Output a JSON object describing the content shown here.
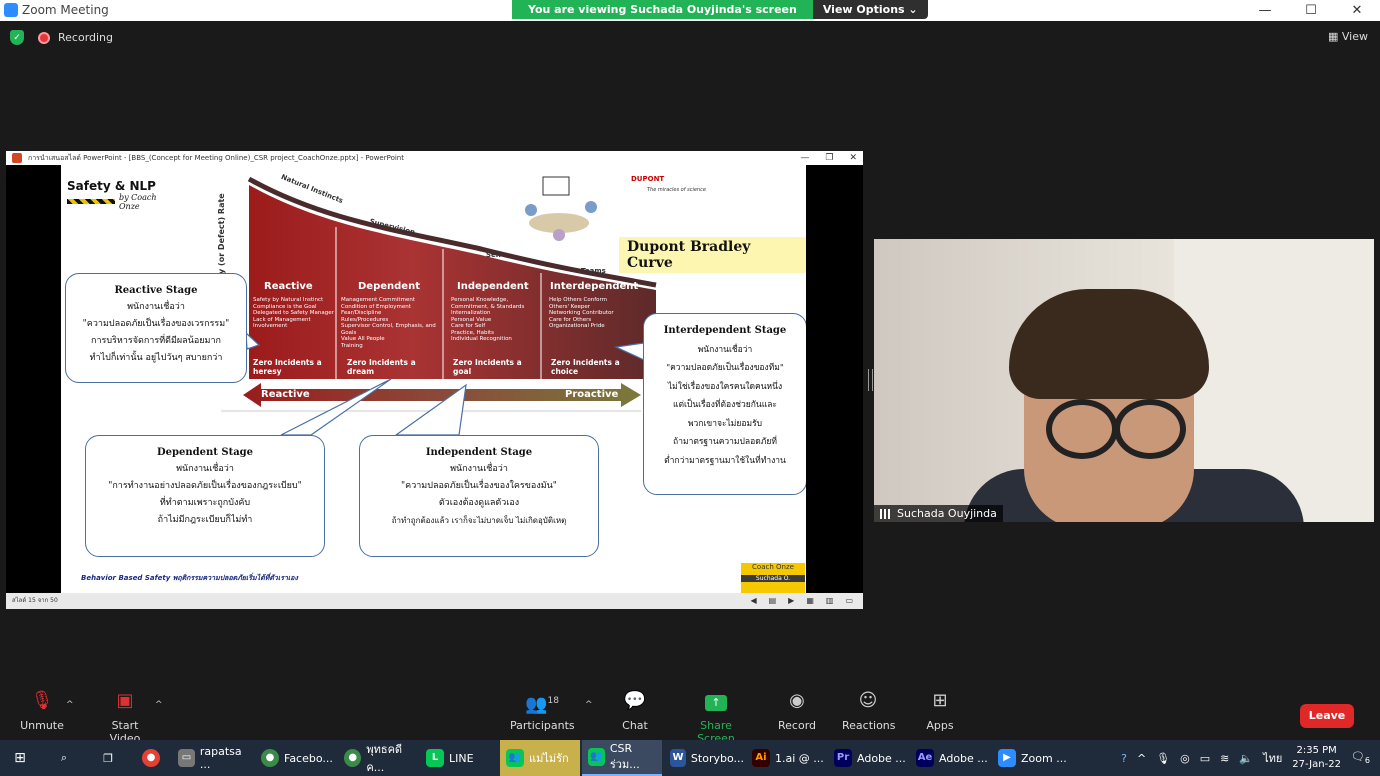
{
  "window": {
    "title": "Zoom Meeting",
    "minimize": "—",
    "maximize": "☐",
    "close": "✕"
  },
  "banner": {
    "message": "You are viewing Suchada Ouyjinda's screen",
    "view_options": "View Options ⌄"
  },
  "status": {
    "recording": "Recording",
    "view": "View"
  },
  "ppt": {
    "title": "การนำเสนอสไลด์ PowerPoint - [BBS_(Concept for Meeting Online)_CSR project_CoachOnze.pptx] - PowerPoint",
    "status": "สไลด์ 15 จาก 50",
    "slide": {
      "logo_name": "Safety & NLP",
      "logo_sub": "by Coach Onze",
      "dupont": "DUPONT",
      "dupont_sub": "The miracles of science",
      "curve_title": "Dupont Bradley Curve",
      "ylabel": "Injury (or Defect) Rate",
      "curve_labels": [
        "Natural Instincts",
        "Supervision",
        "Self",
        "Teams"
      ],
      "stages": [
        "Reactive",
        "Dependent",
        "Independent",
        "Interdependent"
      ],
      "columns": [
        [
          "Safety by Natural Instinct",
          "Compliance is the Goal",
          "Delegated to Safety Manager",
          "Lack of Management Involvement"
        ],
        [
          "Management Commitment",
          "Condition of Employment",
          "Fear/Discipline",
          "Rules/Procedures",
          "Supervisor Control, Emphasis, and Goals",
          "Value All People",
          "Training"
        ],
        [
          "Personal Knowledge, Commitment, & Standards",
          "Internalization",
          "Personal Value",
          "Care for Self",
          "Practice, Habits",
          "Individual Recognition"
        ],
        [
          "Help Others Conform",
          "Others' Keeper",
          "Networking Contributor",
          "Care for Others",
          "Organizational Pride"
        ]
      ],
      "zero": [
        "Zero Incidents a heresy",
        "Zero Incidents a dream",
        "Zero Incidents a goal",
        "Zero Incidents a choice"
      ],
      "arrow_left": "Reactive",
      "arrow_right": "Proactive",
      "bubbles": {
        "reactive": {
          "head": "Reactive Stage",
          "lines": [
            "พนักงานเชื่อว่า",
            "\"ความปลอดภัยเป็นเรื่องของเวรกรรม\"",
            "การบริหารจัดการที่ดีมีผลน้อยมาก",
            "ทำไปก็เท่านั้น อยู่ไปวันๆ สบายกว่า"
          ]
        },
        "dependent": {
          "head": "Dependent Stage",
          "lines": [
            "พนักงานเชื่อว่า",
            "\"การทำงานอย่างปลอดภัยเป็นเรื่องของกฎระเบียบ\"",
            "ที่ทำตามเพราะถูกบังคับ",
            "ถ้าไม่มีกฎระเบียบก็ไม่ทำ"
          ]
        },
        "independent": {
          "head": "Independent Stage",
          "lines": [
            "พนักงานเชื่อว่า",
            "\"ความปลอดภัยเป็นเรื่องของใครของมัน\"",
            "ตัวเองต้องดูแลตัวเอง",
            "ถ้าทำถูกต้องแล้ว เราก็จะไม่บาดเจ็บ ไม่เกิดอุบัติเหตุ"
          ]
        },
        "interdependent": {
          "head": "Interdependent Stage",
          "lines": [
            "พนักงานเชื่อว่า",
            "\"ความปลอดภัยเป็นเรื่องของทีม\"",
            "ไม่ใช่เรื่องของใครคนใดคนหนึ่ง",
            "แต่เป็นเรื่องที่ต้องช่วยกันและ",
            "พวกเขาจะไม่ยอมรับ",
            "ถ้ามาตรฐานความปลอดภัยที่",
            "ต่ำกว่ามาตรฐานมาใช้ในที่ทำงาน"
          ]
        }
      },
      "footer": "Behavior Based Safety พฤติกรรมความปลอดภัยเริ่มได้ที่ตัวเราเอง",
      "badge": "Coach Onze",
      "badge_name": "Suchada O."
    }
  },
  "participant": {
    "name": "Suchada Ouyjinda"
  },
  "controls": {
    "unmute": "Unmute",
    "start_video": "Start Video",
    "participants": "Participants",
    "participants_count": "18",
    "chat": "Chat",
    "share": "Share Screen",
    "record": "Record",
    "reactions": "Reactions",
    "apps": "Apps",
    "leave": "Leave"
  },
  "taskbar": {
    "items": [
      "rapatsa ...",
      "Facebo...",
      "พุทธคดีค...",
      "LINE",
      "แม่ไม่รัก",
      "CSR ร่วม...",
      "Storybo...",
      "1.ai @ ...",
      "Adobe ...",
      "Adobe ...",
      "Zoom ..."
    ],
    "lang": "ไทย",
    "time": "2:35 PM",
    "date": "27-Jan-22",
    "notif": "6"
  }
}
